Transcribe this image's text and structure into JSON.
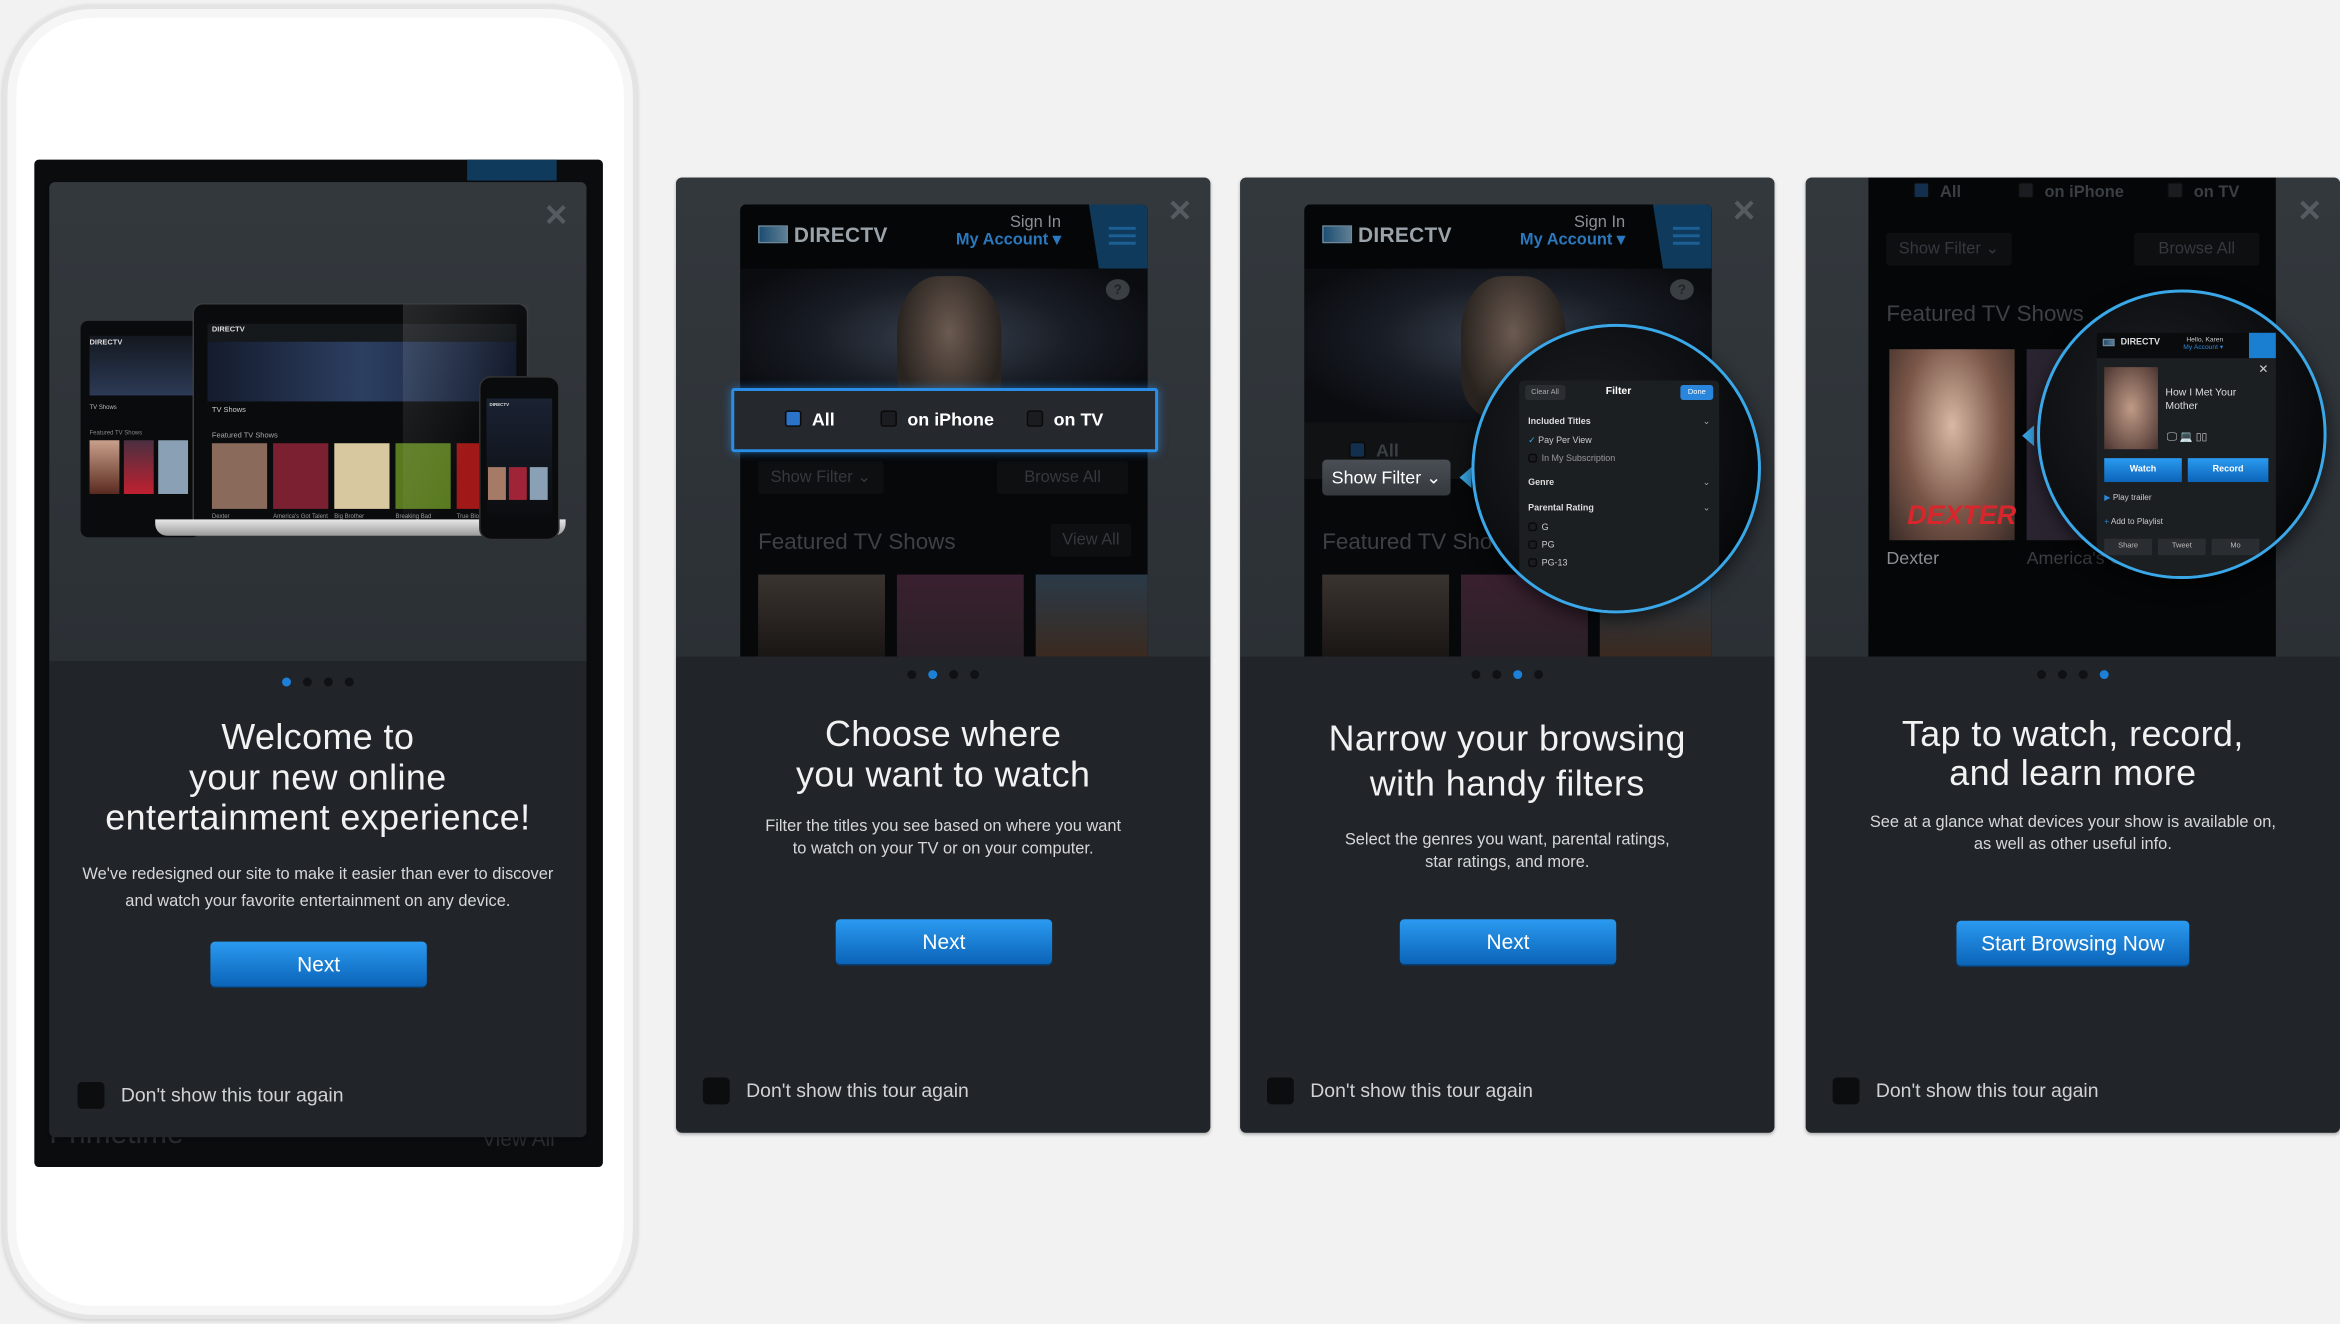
{
  "colors": {
    "accent": "#1c7fd8",
    "highlight": "#3aa8e8",
    "panel": "#262a2f",
    "background": "#f2f2f2"
  },
  "common": {
    "dont_show": "Don't show this tour again",
    "close_icon": "close-icon"
  },
  "brand": {
    "name": "DIRECTV",
    "sign_in": "Sign In",
    "my_account": "My Account ▾",
    "help": "?"
  },
  "browse": {
    "all": "All",
    "on_iphone": "on iPhone",
    "on_tv": "on TV",
    "show_filter": "Show Filter ⌄",
    "browse_all": "Browse All",
    "featured": "Featured TV Shows",
    "view_all": "View All"
  },
  "slides": [
    {
      "title_lines": [
        "Welcome to",
        "your new online",
        "entertainment experience!"
      ],
      "body_lines": [
        "We've redesigned our site to make it easier than ever to discover",
        "and watch your favorite entertainment on any device."
      ],
      "button": "Next",
      "active_dot": 1,
      "mockup": {
        "section": "TV Shows",
        "featured": "Featured TV Shows",
        "shows": [
          "Dexter",
          "America's Got Talent",
          "Big Brother",
          "Breaking Bad",
          "True Blood"
        ],
        "behind_title": "Primetime",
        "behind_view_all": "View All"
      }
    },
    {
      "title_lines": [
        "Choose where",
        "you want to watch"
      ],
      "body_lines": [
        "Filter the titles you see based on where you want",
        "to watch on your TV or on your computer."
      ],
      "button": "Next",
      "active_dot": 2
    },
    {
      "title_lines": [
        "Narrow your browsing",
        "with handy filters"
      ],
      "body_lines": [
        "Select the genres you want, parental ratings,",
        "star ratings, and more."
      ],
      "button": "Next",
      "active_dot": 3,
      "filter": {
        "clear_all": "Clear All",
        "title": "Filter",
        "done": "Done",
        "included": "Included Titles",
        "pay_per_view": "Pay Per View",
        "pay_per_view_checked": true,
        "subscription": "In My Subscription",
        "genre": "Genre",
        "parental": "Parental Rating",
        "ratings": [
          "G",
          "PG",
          "PG-13"
        ]
      }
    },
    {
      "title_lines": [
        "Tap to watch, record,",
        "and learn more"
      ],
      "body_lines": [
        "See at a glance what devices your show is available on,",
        "as well as other useful info."
      ],
      "button": "Start Browsing Now",
      "active_dot": 4,
      "show_label": "Dexter",
      "show_label_2": "America's G",
      "detail": {
        "greeting": "Hello, Karen",
        "account": "My Account ▾",
        "poster_title": "DEXTER",
        "title": "How I Met Your Mother",
        "watch": "Watch",
        "record": "Record",
        "play_trailer": "Play trailer",
        "add_playlist": "Add to Playlist",
        "share": "Share",
        "tweet": "Tweet",
        "more": "Mo"
      }
    }
  ]
}
